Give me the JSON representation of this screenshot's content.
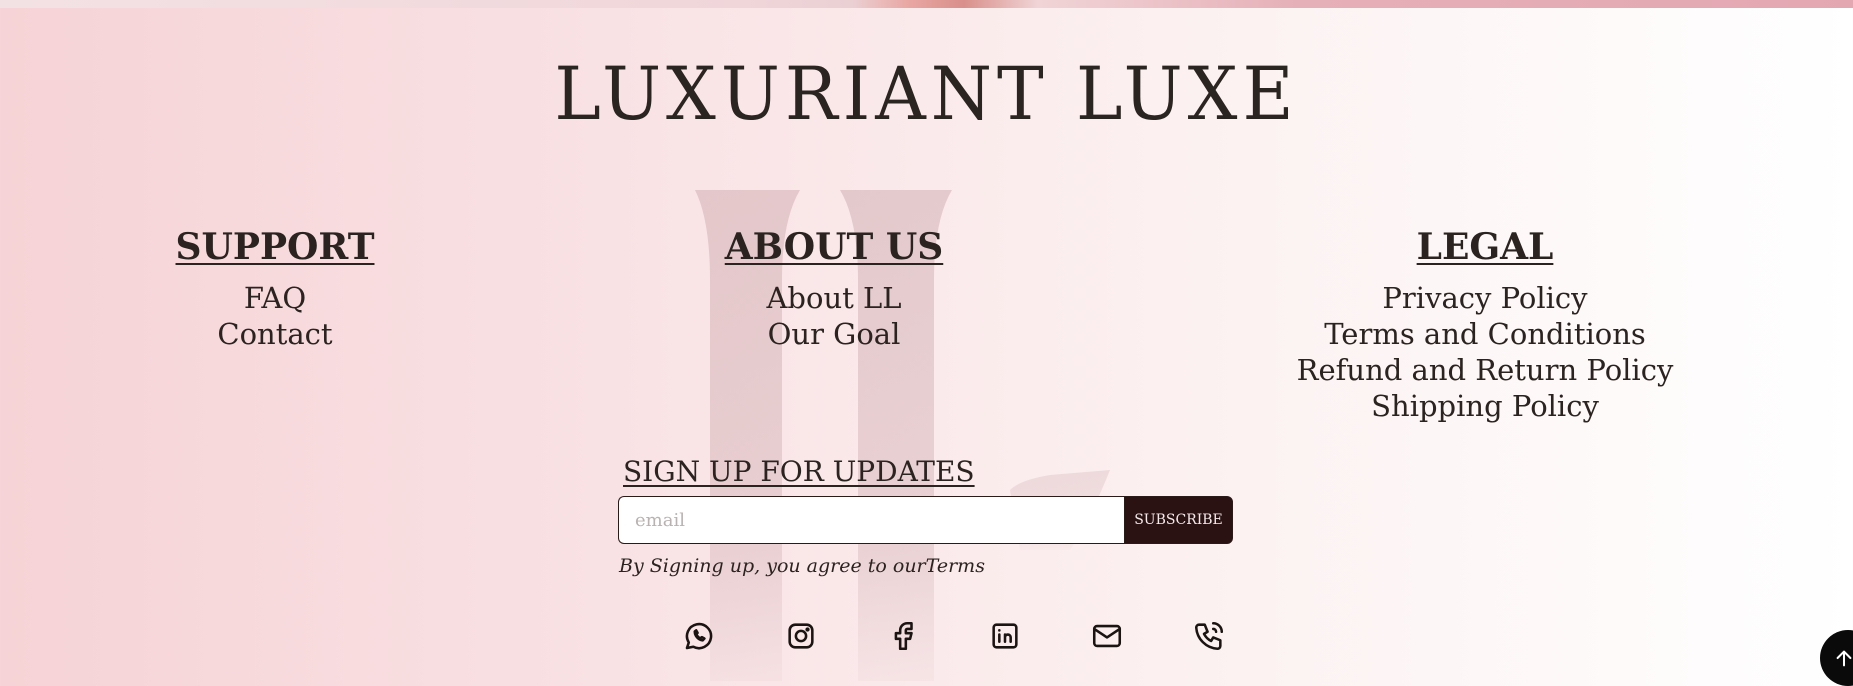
{
  "brand": {
    "name": "LUXURIANT LUXE"
  },
  "footer": {
    "columns": [
      {
        "heading": "SUPPORT",
        "links": [
          "FAQ",
          "Contact"
        ]
      },
      {
        "heading": "ABOUT US",
        "links": [
          "About LL",
          "Our Goal"
        ]
      },
      {
        "heading": "LEGAL",
        "links": [
          "Privacy Policy",
          "Terms and Conditions",
          "Refund and Return Policy",
          "Shipping Policy"
        ]
      }
    ],
    "signup": {
      "title": "SIGN UP FOR UPDATES",
      "placeholder": "email",
      "button": "SUBSCRIBE",
      "terms_prefix": "By Signing up, you agree to our",
      "terms_link": "Terms"
    },
    "socials": [
      "whatsapp-icon",
      "instagram-icon",
      "facebook-icon",
      "linkedin-icon",
      "mail-icon",
      "phone-icon"
    ]
  },
  "colors": {
    "text": "#2a2320",
    "button_bg": "#2a1212",
    "bg_left": "#f6d3d6",
    "bg_right": "#ffffff"
  },
  "back_to_top": "arrow-up-icon"
}
